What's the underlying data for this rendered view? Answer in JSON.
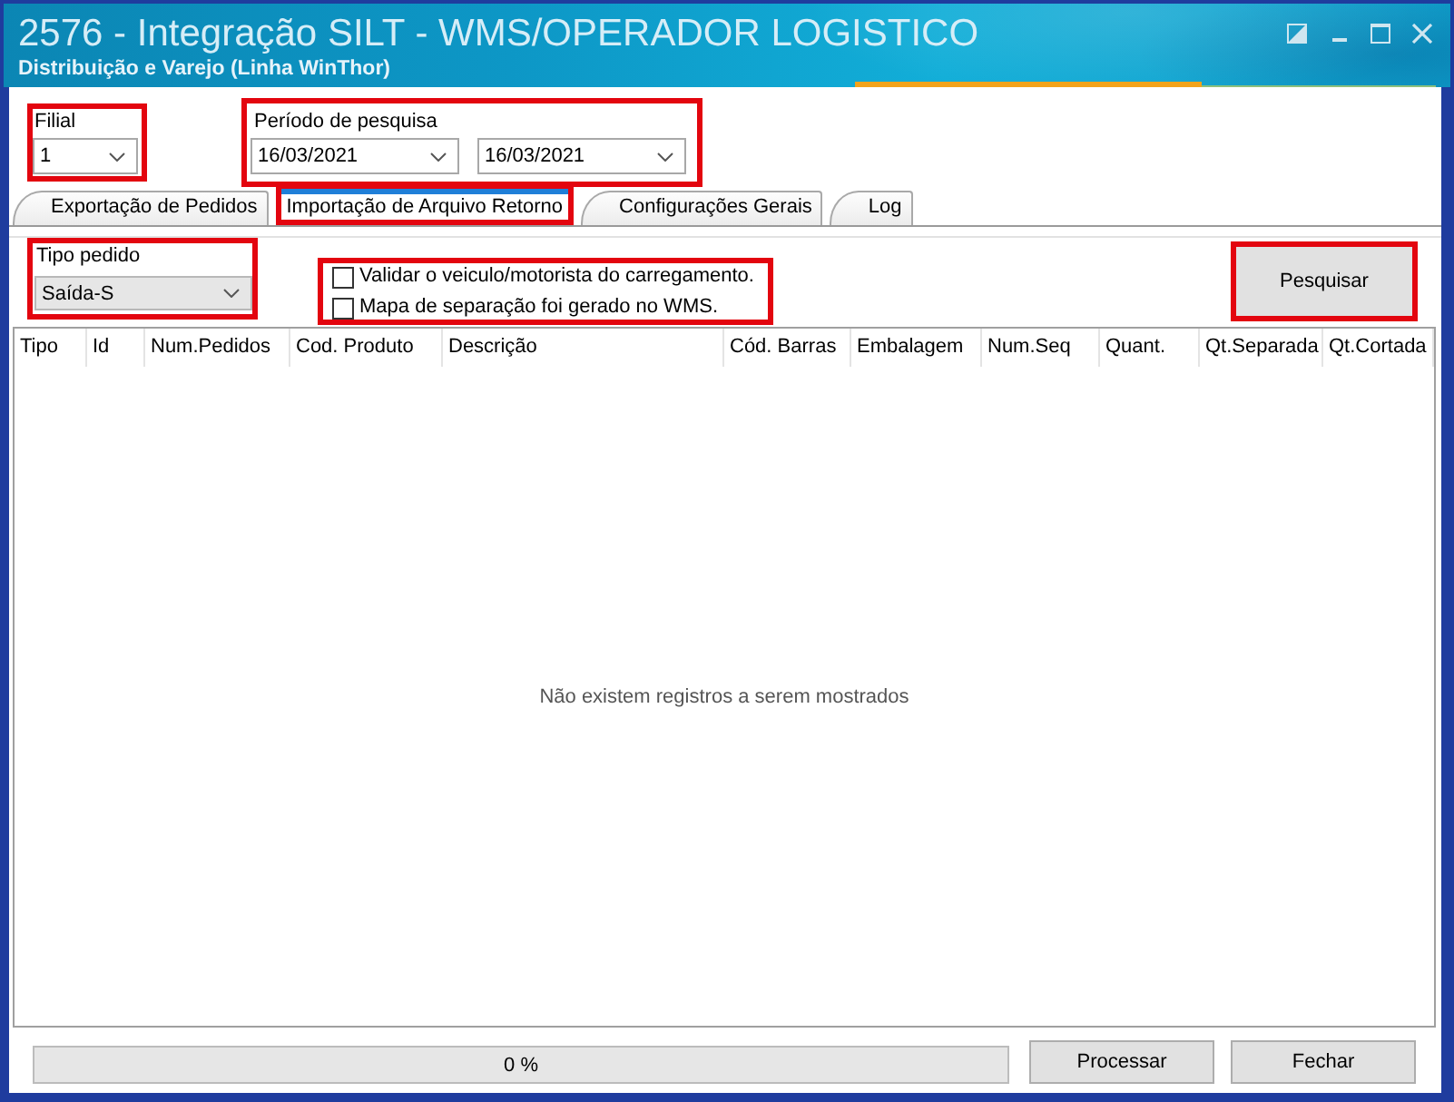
{
  "window": {
    "title": "2576 - Integração SILT - WMS/OPERADOR LOGISTICO",
    "subtitle": "Distribuição e Varejo (Linha WinThor)"
  },
  "filial": {
    "label": "Filial",
    "value": "1",
    "highlighted": true
  },
  "period": {
    "label": "Período de pesquisa",
    "start": "16/03/2021",
    "end": "16/03/2021",
    "highlighted": true
  },
  "tabs": [
    {
      "label": "Exportação de Pedidos",
      "selected": false,
      "highlighted": false
    },
    {
      "label": "Importação de Arquivo Retorno",
      "selected": true,
      "highlighted": true
    },
    {
      "label": "Configurações Gerais",
      "selected": false,
      "highlighted": false
    },
    {
      "label": "Log",
      "selected": false,
      "highlighted": false
    }
  ],
  "order_type": {
    "label": "Tipo pedido",
    "value": "Saída-S",
    "highlighted": true
  },
  "options": {
    "highlighted": true,
    "items": [
      {
        "label": "Validar o veiculo/motorista do carregamento.",
        "checked": false
      },
      {
        "label": "Mapa de separação foi gerado no WMS.",
        "checked": false
      }
    ]
  },
  "search_button": {
    "label": "Pesquisar",
    "highlighted": true
  },
  "table": {
    "columns": [
      "Tipo",
      "Id",
      "Num.Pedidos",
      "Cod. Produto",
      "Descrição",
      "Cód. Barras",
      "Embalagem",
      "Num.Seq",
      "Quant.",
      "Qt.Separada",
      "Qt.Cortada"
    ],
    "empty_message": "Não existem registros a serem mostrados"
  },
  "progress": {
    "level": 0,
    "reading": "0 %"
  },
  "buttons": [
    "Processar",
    "Fechar"
  ]
}
